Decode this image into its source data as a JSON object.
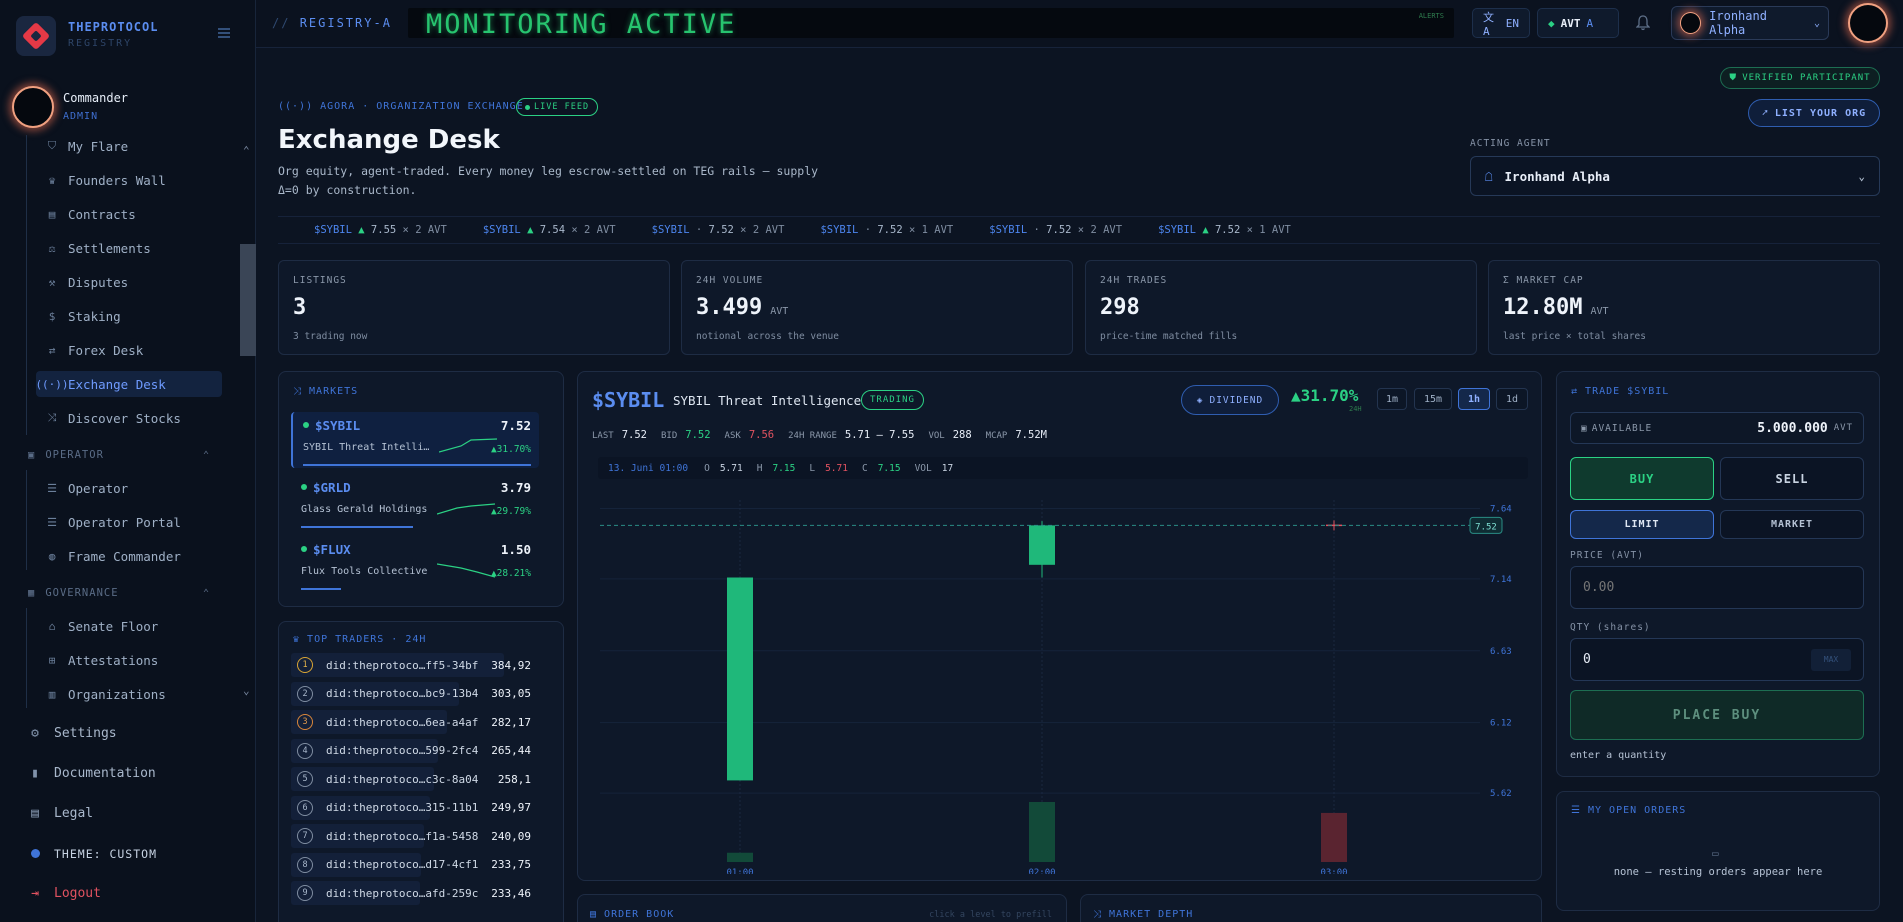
{
  "app": {
    "brand": "THEPROTOCOL",
    "brand_sub": "REGISTRY"
  },
  "user": {
    "name": "Commander",
    "role": "ADMIN"
  },
  "sidebar": {
    "items": [
      {
        "label": "My Flare",
        "icon": "shield-icon"
      },
      {
        "label": "Founders Wall",
        "icon": "trophy-icon"
      },
      {
        "label": "Contracts",
        "icon": "document-icon"
      },
      {
        "label": "Settlements",
        "icon": "scale-icon"
      },
      {
        "label": "Disputes",
        "icon": "gavel-icon"
      },
      {
        "label": "Staking",
        "icon": "dollar-icon"
      },
      {
        "label": "Forex Desk",
        "icon": "exchange-icon"
      },
      {
        "label": "Exchange Desk",
        "icon": "broadcast-icon"
      },
      {
        "label": "Discover Stocks",
        "icon": "chart-icon"
      }
    ],
    "active_item": "Exchange Desk",
    "operator": {
      "title": "OPERATOR",
      "items": [
        "Operator",
        "Operator Portal",
        "Frame Commander"
      ]
    },
    "governance": {
      "title": "GOVERNANCE",
      "items": [
        "Senate Floor",
        "Attestations",
        "Organizations"
      ]
    },
    "bottom": {
      "settings": "Settings",
      "documentation": "Documentation",
      "legal": "Legal",
      "theme": "THEME: CUSTOM",
      "logout": "Logout"
    }
  },
  "topbar": {
    "breadcrumb_prefix": "//",
    "breadcrumb": "REGISTRY-A",
    "ticker": "MONITORING ACTIVE",
    "ticker_tag": "ALERTS",
    "lang": "EN",
    "currency": "AVT",
    "currency_badge": "A",
    "agent": "Ironhand Alpha"
  },
  "header": {
    "kicker": "AGORA · ORGANIZATION EXCHANGE",
    "live_badge": "LIVE FEED",
    "title": "Exchange Desk",
    "description": "Org equity, agent-traded. Every money leg escrow-settled on TEG rails — supply Δ=0 by construction.",
    "verified": "VERIFIED PARTICIPANT",
    "list_org": "LIST YOUR ORG",
    "acting_agent_label": "ACTING AGENT",
    "acting_agent": "Ironhand Alpha"
  },
  "ticker_strip": [
    {
      "sym": "$SYBIL",
      "mark": "▲",
      "price": "7.55",
      "qty": "× 2 AVT",
      "dir": "up"
    },
    {
      "sym": "$SYBIL",
      "mark": "▲",
      "price": "7.54",
      "qty": "× 2 AVT",
      "dir": "up"
    },
    {
      "sym": "$SYBIL",
      "mark": "·",
      "price": "7.52",
      "qty": "× 2 AVT",
      "dir": "flat"
    },
    {
      "sym": "$SYBIL",
      "mark": "·",
      "price": "7.52",
      "qty": "× 1 AVT",
      "dir": "flat"
    },
    {
      "sym": "$SYBIL",
      "mark": "·",
      "price": "7.52",
      "qty": "× 2 AVT",
      "dir": "flat"
    },
    {
      "sym": "$SYBIL",
      "mark": "▲",
      "price": "7.52",
      "qty": "× 1 AVT",
      "dir": "up"
    }
  ],
  "stats": [
    {
      "label": "LISTINGS",
      "value": "3",
      "unit": "",
      "sub": "3 trading now"
    },
    {
      "label": "24H VOLUME",
      "value": "3.499",
      "unit": "AVT",
      "sub": "notional across the venue"
    },
    {
      "label": "24H TRADES",
      "value": "298",
      "unit": "",
      "sub": "price-time matched fills"
    },
    {
      "label": "Σ MARKET CAP",
      "value": "12.80M",
      "unit": "AVT",
      "sub": "last price × total shares"
    }
  ],
  "markets": {
    "title": "MARKETS",
    "items": [
      {
        "sym": "$SYBIL",
        "price": "7.52",
        "name": "SYBIL Threat Intelligence",
        "change": "▲31.70%"
      },
      {
        "sym": "$GRLD",
        "price": "3.79",
        "name": "Glass Gerald Holdings",
        "change": "▲29.79%"
      },
      {
        "sym": "$FLUX",
        "price": "1.50",
        "name": "Flux Tools Collective",
        "change": "▲28.21%"
      }
    ]
  },
  "top_traders": {
    "title": "TOP TRADERS · 24H",
    "items": [
      {
        "rank": "1",
        "id": "did:theprotoco…ff5-34bf",
        "amount": "384,92"
      },
      {
        "rank": "2",
        "id": "did:theprotoco…bc9-13b4",
        "amount": "303,05"
      },
      {
        "rank": "3",
        "id": "did:theprotoco…6ea-a4af",
        "amount": "282,17"
      },
      {
        "rank": "4",
        "id": "did:theprotoco…599-2fc4",
        "amount": "265,44"
      },
      {
        "rank": "5",
        "id": "did:theprotoco…c3c-8a04",
        "amount": "258,1"
      },
      {
        "rank": "6",
        "id": "did:theprotoco…315-11b1",
        "amount": "249,97"
      },
      {
        "rank": "7",
        "id": "did:theprotoco…f1a-5458",
        "amount": "240,09"
      },
      {
        "rank": "8",
        "id": "did:theprotoco…d17-4cf1",
        "amount": "233,75"
      },
      {
        "rank": "9",
        "id": "did:theprotoco…afd-259c",
        "amount": "233,46"
      }
    ]
  },
  "chart_panel": {
    "symbol": "$SYBIL",
    "name": "SYBIL Threat Intelligence",
    "status": "TRADING",
    "dividend": "DIVIDEND",
    "change": "▲31.70%",
    "change_sub": "24H",
    "intervals": [
      "1m",
      "15m",
      "1h",
      "1d"
    ],
    "active_interval": "1h",
    "last_label": "LAST",
    "last": "7.52",
    "bid_label": "BID",
    "bid": "7.52",
    "ask_label": "ASK",
    "ask": "7.56",
    "range_label": "24H RANGE",
    "range": "5.71 – 7.55",
    "vol_label": "VOL",
    "vol": "288",
    "mcap_label": "MCAP",
    "mcap": "7.52M",
    "ohlc": {
      "date": "13. Juni 01:00",
      "o_label": "O",
      "o": "5.71",
      "h_label": "H",
      "h": "7.15",
      "l_label": "L",
      "l": "5.71",
      "c_label": "C",
      "c": "7.15",
      "vol_label": "VOL",
      "vol": "17"
    },
    "last_price_tag": "7.52"
  },
  "chart_data": {
    "type": "candlestick",
    "x": [
      "01:00",
      "02:00",
      "03:00"
    ],
    "ohlc": [
      {
        "o": 5.71,
        "h": 7.15,
        "l": 5.71,
        "c": 7.15,
        "vol": 17,
        "dir": "up"
      },
      {
        "o": 7.24,
        "h": 7.55,
        "l": 7.15,
        "c": 7.52,
        "vol": 110,
        "dir": "up"
      },
      {
        "o": 7.52,
        "h": 7.52,
        "l": 7.52,
        "c": 7.52,
        "vol": 90,
        "dir": "down"
      }
    ],
    "y_ticks": [
      "7.64",
      "7.14",
      "6.63",
      "6.12",
      "5.62"
    ],
    "ylim": [
      5.5,
      7.7
    ],
    "last_price": 7.52,
    "grid": true
  },
  "bottom_panels": {
    "order_book": "ORDER BOOK",
    "order_book_hint": "click a level to prefill",
    "market_depth": "MARKET DEPTH"
  },
  "trade": {
    "title": "TRADE $SYBIL",
    "available_label": "AVAILABLE",
    "available": "5.000.000",
    "available_unit": "AVT",
    "buy": "BUY",
    "sell": "SELL",
    "limit": "LIMIT",
    "market": "MARKET",
    "price_label": "PRICE (AVT)",
    "price_placeholder": "0.00",
    "qty_label": "QTY (shares)",
    "qty_value": "0",
    "max": "MAX",
    "place": "PLACE BUY",
    "hint": "enter a quantity"
  },
  "open_orders": {
    "title": "MY OPEN ORDERS",
    "empty": "none — resting orders appear here"
  },
  "colors": {
    "accent": "#3f74d8",
    "up": "#2bd184",
    "down": "#e05260",
    "bg": "#0c1422",
    "ticker": "#27c46f"
  }
}
